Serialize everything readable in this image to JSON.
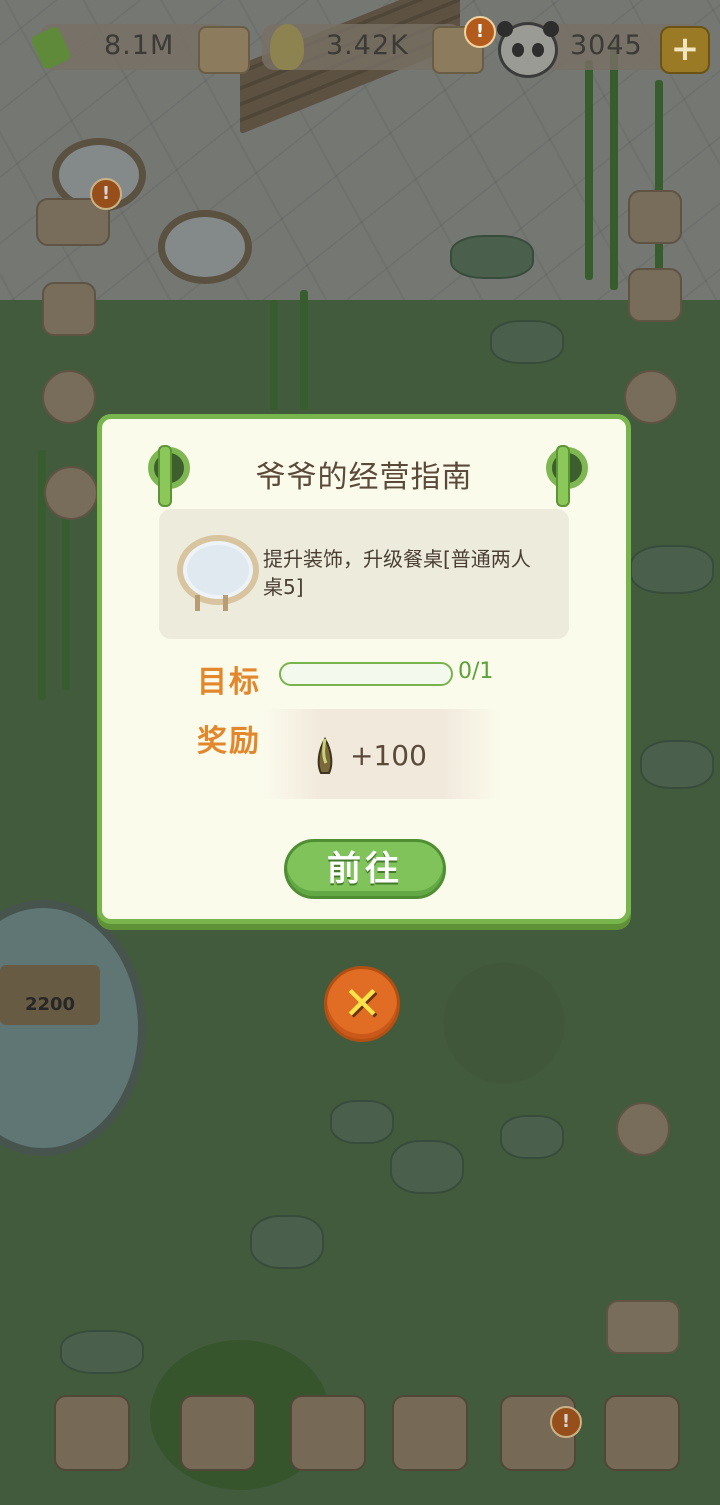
{
  "resources": {
    "bamboo": "8.1M",
    "shoots": "3.42K",
    "panda": "3045",
    "plus_label": "+"
  },
  "badges": {
    "alert": "!"
  },
  "scene": {
    "sign_value": "2200"
  },
  "dialog": {
    "title": "爷爷的经营指南",
    "task_text": "提升装饰，升级餐桌[普通两人桌5]",
    "goal_label": "目标",
    "progress_value": 0,
    "progress_text": "0/1",
    "reward_label": "奖励",
    "reward_amount": "+100",
    "go_button": "前往"
  },
  "close_symbol": "✕",
  "colors": {
    "dialog_border": "#78b54d",
    "accent_orange": "#e2872b",
    "button_green": "#7fc35a",
    "close_orange": "#e16c23"
  }
}
